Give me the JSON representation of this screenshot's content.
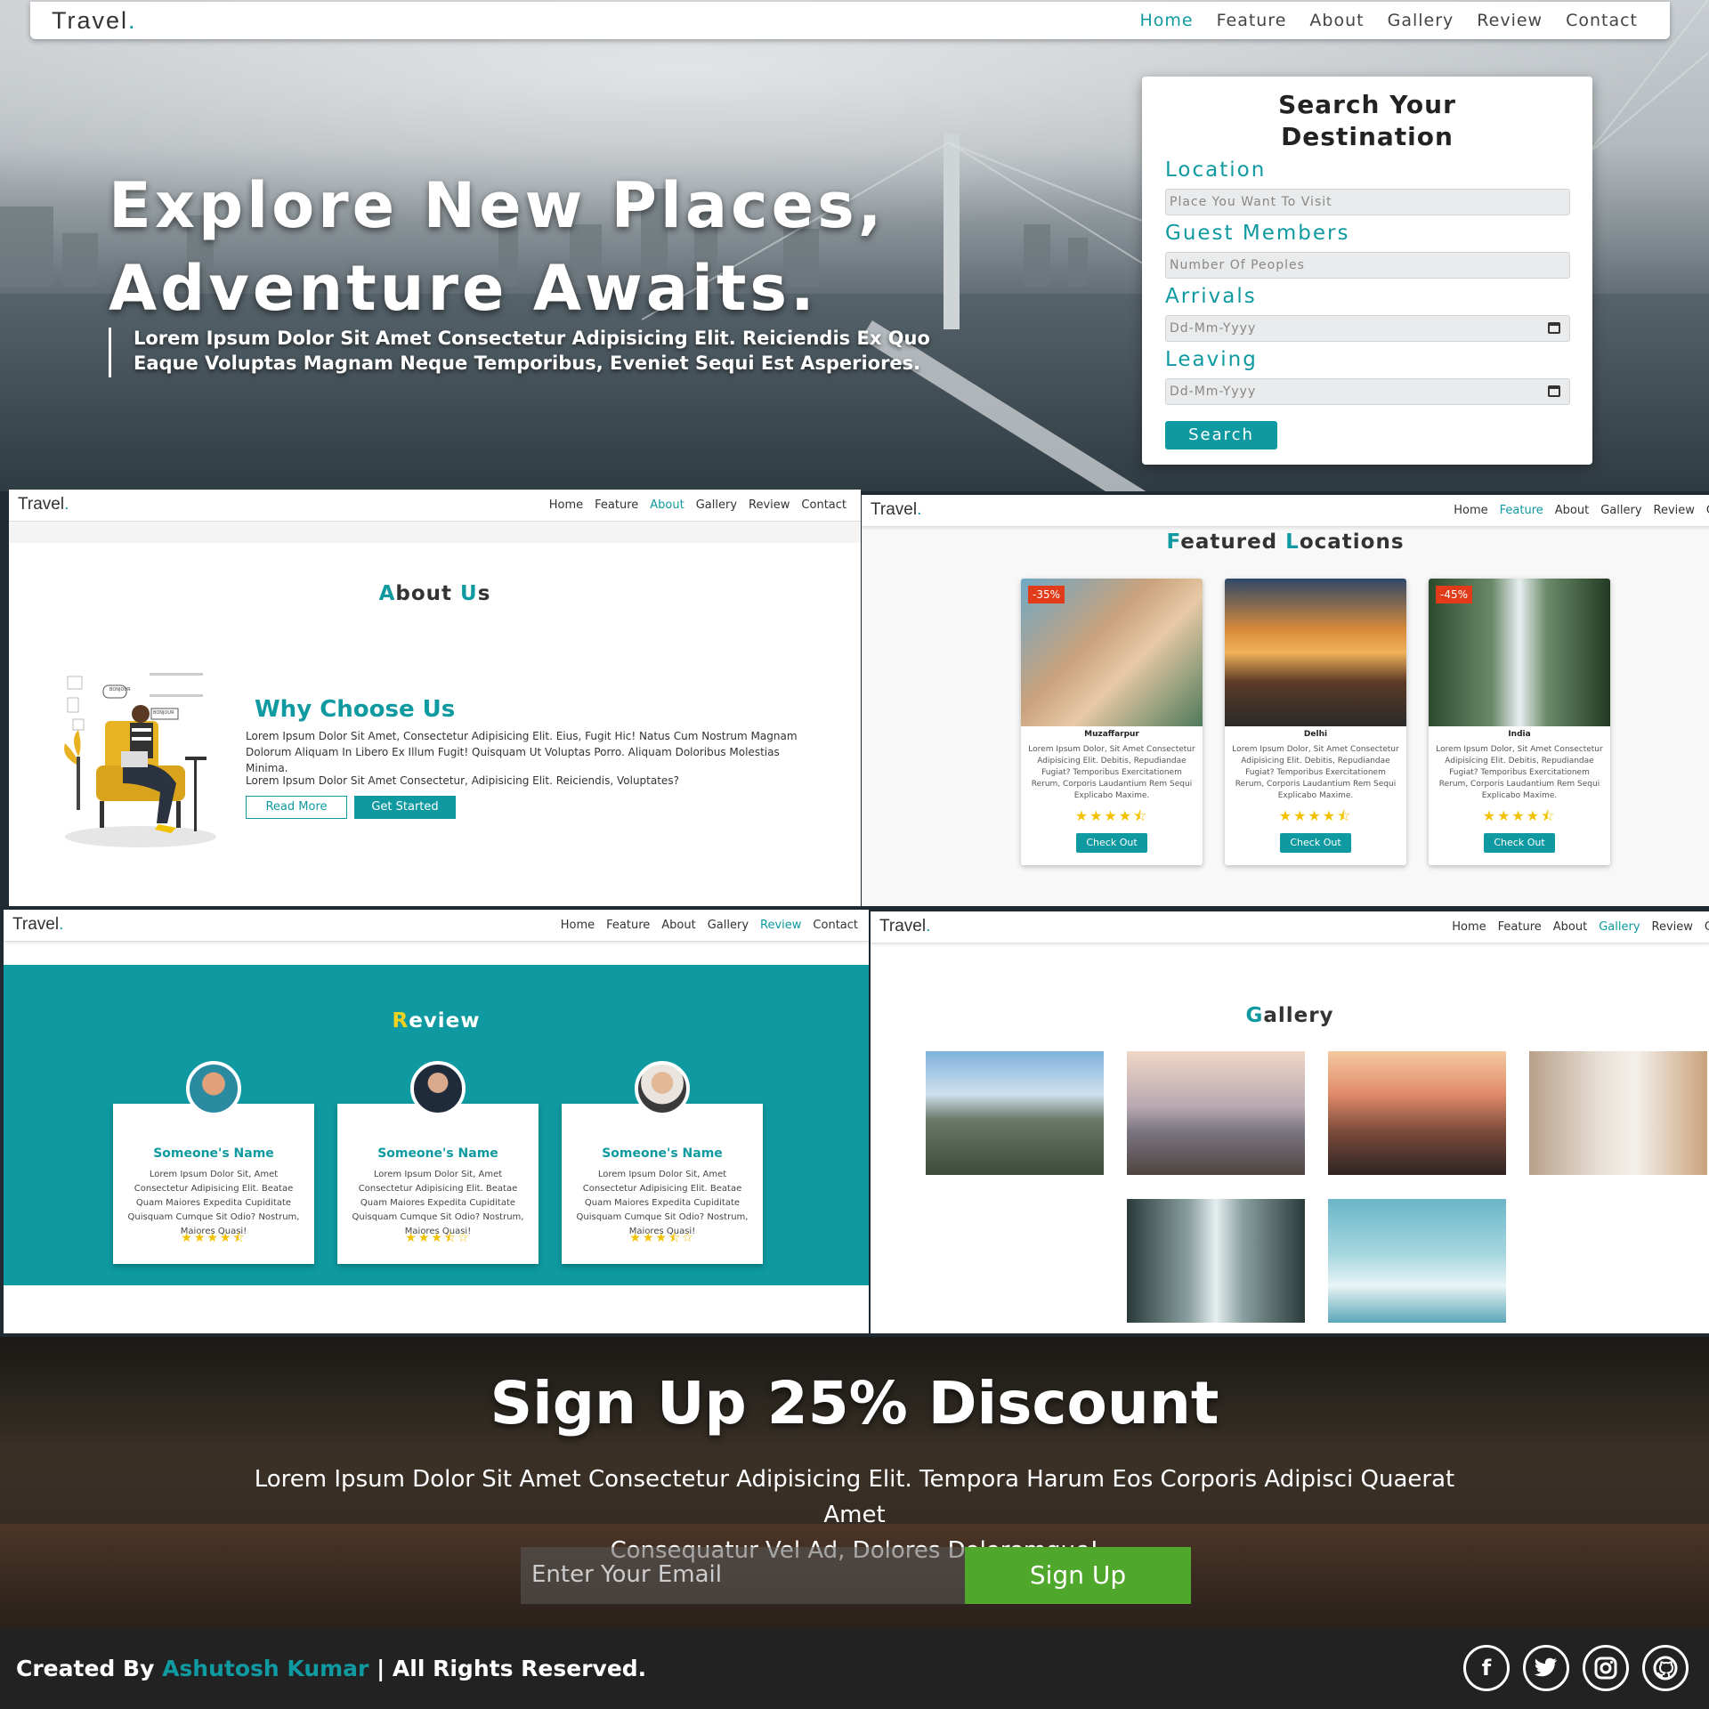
{
  "brand": {
    "logo": "Travel",
    "logo_dot": "."
  },
  "colors": {
    "accent": "#0e9aa0",
    "star": "#f2c200",
    "discount": "#e23b1a",
    "signup_button": "#4fa82c"
  },
  "hero": {
    "nav": [
      "Home",
      "Feature",
      "About",
      "Gallery",
      "Review",
      "Contact"
    ],
    "title_line1": "Explore New Places,",
    "title_line2": "Adventure Awaits.",
    "subtitle_line1": "Lorem Ipsum Dolor Sit Amet Consectetur Adipisicing Elit. Reiciendis Ex Quo",
    "subtitle_line2": "Eaque Voluptas Magnam Neque Temporibus, Eveniet Sequi Est Asperiores.",
    "search": {
      "title_line1": "Search Your",
      "title_line2": "Destination",
      "location_label": "Location",
      "location_placeholder": "Place You Want To Visit",
      "guests_label": "Guest Members",
      "guests_placeholder": "Number Of Peoples",
      "arrivals_label": "Arrivals",
      "arrivals_placeholder": "Dd-Mm-Yyyy",
      "leaving_label": "Leaving",
      "leaving_placeholder": "Dd-Mm-Yyyy",
      "button": "Search"
    }
  },
  "about": {
    "nav": [
      "Home",
      "Feature",
      "About",
      "Gallery",
      "Review",
      "Contact"
    ],
    "title_first": "A",
    "title_rest1": "bout ",
    "title_u": "U",
    "title_rest2": "s",
    "why_title": "Why Choose Us",
    "p1": "Lorem Ipsum Dolor Sit Amet, Consectetur Adipisicing Elit. Eius, Fugit Hic! Natus Cum Nostrum Magnam Dolorum Aliquam In Libero Ex Illum Fugit! Quisquam Ut Voluptas Porro. Aliquam Doloribus Molestias Minima.",
    "p2": "Lorem Ipsum Dolor Sit Amet Consectetur, Adipisicing Elit. Reiciendis, Voluptates?",
    "read_more": "Read More",
    "get_started": "Get Started",
    "illustration_bubble1": "BONJOUR",
    "illustration_bubble2": "BONJOUR"
  },
  "featured": {
    "nav": [
      "Home",
      "Feature",
      "About",
      "Gallery",
      "Review",
      "C"
    ],
    "title_f": "F",
    "title_rest1": "eatured ",
    "title_l": "L",
    "title_rest2": "ocations",
    "cards": [
      {
        "discount": "-35%",
        "name": "Muzaffarpur",
        "desc": "Lorem Ipsum Dolor, Sit Amet Consectetur Adipisicing Elit. Debitis, Repudiandae Fugiat? Temporibus Exercitationem Rerum, Corporis Laudantium Rem Sequi Explicabo Maxime.",
        "stars": "★★★★⯪",
        "button": "Check Out"
      },
      {
        "discount": "",
        "name": "Delhi",
        "desc": "Lorem Ipsum Dolor, Sit Amet Consectetur Adipisicing Elit. Debitis, Repudiandae Fugiat? Temporibus Exercitationem Rerum, Corporis Laudantium Rem Sequi Explicabo Maxime.",
        "stars": "★★★★⯪",
        "button": "Check Out"
      },
      {
        "discount": "-45%",
        "name": "India",
        "desc": "Lorem Ipsum Dolor, Sit Amet Consectetur Adipisicing Elit. Debitis, Repudiandae Fugiat? Temporibus Exercitationem Rerum, Corporis Laudantium Rem Sequi Explicabo Maxime.",
        "stars": "★★★★⯪",
        "button": "Check Out"
      }
    ]
  },
  "review": {
    "nav": [
      "Home",
      "Feature",
      "About",
      "Gallery",
      "Review",
      "Contact"
    ],
    "title_r": "R",
    "title_rest": "eview",
    "cards": [
      {
        "name": "Someone's Name",
        "desc": "Lorem Ipsum Dolor Sit, Amet Consectetur Adipisicing Elit. Beatae Quam Maiores Expedita Cupiditate Quisquam Cumque Sit Odio? Nostrum, Maiores Quasi!",
        "stars": "★★★★⯪",
        "rating": 4.5
      },
      {
        "name": "Someone's Name",
        "desc": "Lorem Ipsum Dolor Sit, Amet Consectetur Adipisicing Elit. Beatae Quam Maiores Expedita Cupiditate Quisquam Cumque Sit Odio? Nostrum, Maiores Quasi!",
        "stars": "★★★⯪☆",
        "rating": 3.5
      },
      {
        "name": "Someone's Name",
        "desc": "Lorem Ipsum Dolor Sit, Amet Consectetur Adipisicing Elit. Beatae Quam Maiores Expedita Cupiditate Quisquam Cumque Sit Odio? Nostrum, Maiores Quasi!",
        "stars": "★★★⯪☆",
        "rating": 3.5
      }
    ]
  },
  "gallery": {
    "nav": [
      "Home",
      "Feature",
      "About",
      "Gallery",
      "Review",
      "C"
    ],
    "title_g": "G",
    "title_rest": "allery"
  },
  "signup": {
    "title": "Sign Up 25% Discount",
    "subtitle_line1": "Lorem Ipsum Dolor Sit Amet Consectetur Adipisicing Elit. Tempora Harum Eos Corporis Adipisci Quaerat Amet",
    "subtitle_line2": "Consequatur Vel Ad, Dolores Doloremque!",
    "email_placeholder": "Enter Your Email",
    "button": "Sign Up"
  },
  "footer": {
    "prefix": "Created By ",
    "author": "Ashutosh Kumar",
    "suffix": " | All Rights Reserved.",
    "social_icons": [
      "facebook-icon",
      "twitter-icon",
      "instagram-icon",
      "github-icon"
    ]
  }
}
